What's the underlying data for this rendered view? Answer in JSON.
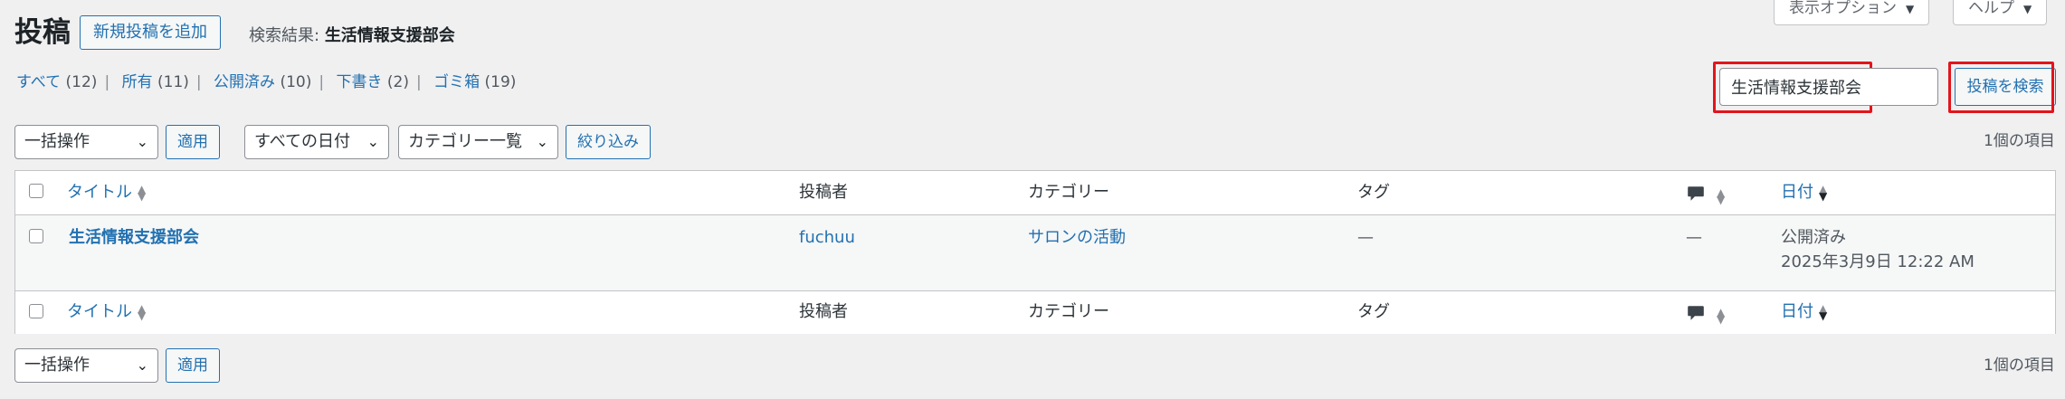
{
  "header": {
    "title": "投稿",
    "add_new": "新規投稿を追加",
    "search_result_label": "検索結果:",
    "search_result_term": "生活情報支援部会"
  },
  "screen_meta": {
    "screen_options": "表示オプション",
    "help": "ヘルプ"
  },
  "views": [
    {
      "label": "すべて",
      "count": "(12)"
    },
    {
      "label": "所有",
      "count": "(11)"
    },
    {
      "label": "公開済み",
      "count": "(10)"
    },
    {
      "label": "下書き",
      "count": "(2)"
    },
    {
      "label": "ゴミ箱",
      "count": "(19)"
    }
  ],
  "search": {
    "value": "生活情報支援部会",
    "button": "投稿を検索"
  },
  "tablenav_top": {
    "bulk_action": "一括操作",
    "apply": "適用",
    "date_filter": "すべての日付",
    "category_filter": "カテゴリー一覧",
    "filter_button": "絞り込み",
    "items_count": "1個の項目"
  },
  "columns": {
    "title": "タイトル",
    "author": "投稿者",
    "categories": "カテゴリー",
    "tags": "タグ",
    "date": "日付"
  },
  "rows": [
    {
      "title": "生活情報支援部会",
      "author": "fuchuu",
      "category": "サロンの活動",
      "tags": "—",
      "comments": "—",
      "status": "公開済み",
      "date": "2025年3月9日 12:22 AM"
    }
  ],
  "tablenav_bottom": {
    "bulk_action": "一括操作",
    "apply": "適用",
    "items_count": "1個の項目"
  },
  "colors": {
    "accent": "#2271b1",
    "highlight_box": "#e3141b",
    "background": "#f0f0f1"
  },
  "icons": [
    "comment-bubble-icon",
    "sort-arrows-icon",
    "chevron-down-icon",
    "caret-down-icon"
  ]
}
